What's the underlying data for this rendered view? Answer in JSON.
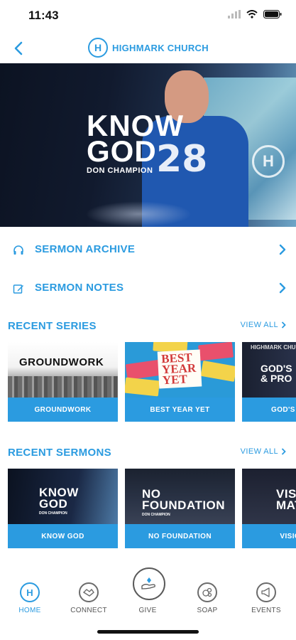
{
  "status_bar": {
    "time": "11:43"
  },
  "header": {
    "brand_letter": "H",
    "title": "HIGHMARK CHURCH"
  },
  "hero": {
    "title_line1": "KNOW",
    "title_line2": "GOD",
    "speaker": "DON CHAMPION",
    "jersey_number": "28",
    "stage_logo_letter": "H"
  },
  "menu": [
    {
      "label": "SERMON ARCHIVE",
      "icon": "headphones-icon"
    },
    {
      "label": "SERMON NOTES",
      "icon": "edit-icon"
    }
  ],
  "recent_series": {
    "title": "RECENT SERIES",
    "view_all": "VIEW ALL",
    "items": [
      {
        "label": "GROUNDWORK",
        "art_text": "GROUNDWORK"
      },
      {
        "label": "BEST YEAR YET",
        "art_line1": "BEST",
        "art_line2": "YEAR",
        "art_line3": "YET"
      },
      {
        "label": "GOD'S PLANS",
        "art_line1": "GOD'S",
        "art_line2": "& PRO",
        "art_brand": "HIGHMARK CHURCH"
      }
    ]
  },
  "recent_sermons": {
    "title": "RECENT SERMONS",
    "view_all": "VIEW ALL",
    "items": [
      {
        "label": "KNOW GOD",
        "art_line1": "KNOW",
        "art_line2": "GOD",
        "art_sub": "DON CHAMPION"
      },
      {
        "label": "NO FOUNDATION",
        "art_line1": "NO",
        "art_line2": "FOUNDATION",
        "art_sub": "DON CHAMPION"
      },
      {
        "label": "VISION M",
        "art_line1": "VISIO",
        "art_line2": "MAT"
      }
    ]
  },
  "tabs": [
    {
      "label": "HOME",
      "icon": "home-logo-icon",
      "active": true
    },
    {
      "label": "CONNECT",
      "icon": "connect-icon",
      "active": false
    },
    {
      "label": "GIVE",
      "icon": "give-icon",
      "active": false
    },
    {
      "label": "SOAP",
      "icon": "soap-icon",
      "active": false
    },
    {
      "label": "EVENTS",
      "icon": "megaphone-icon",
      "active": false
    }
  ],
  "colors": {
    "accent": "#2b9be0",
    "text_dark": "#1a1a1a",
    "tab_inactive": "#555555"
  }
}
